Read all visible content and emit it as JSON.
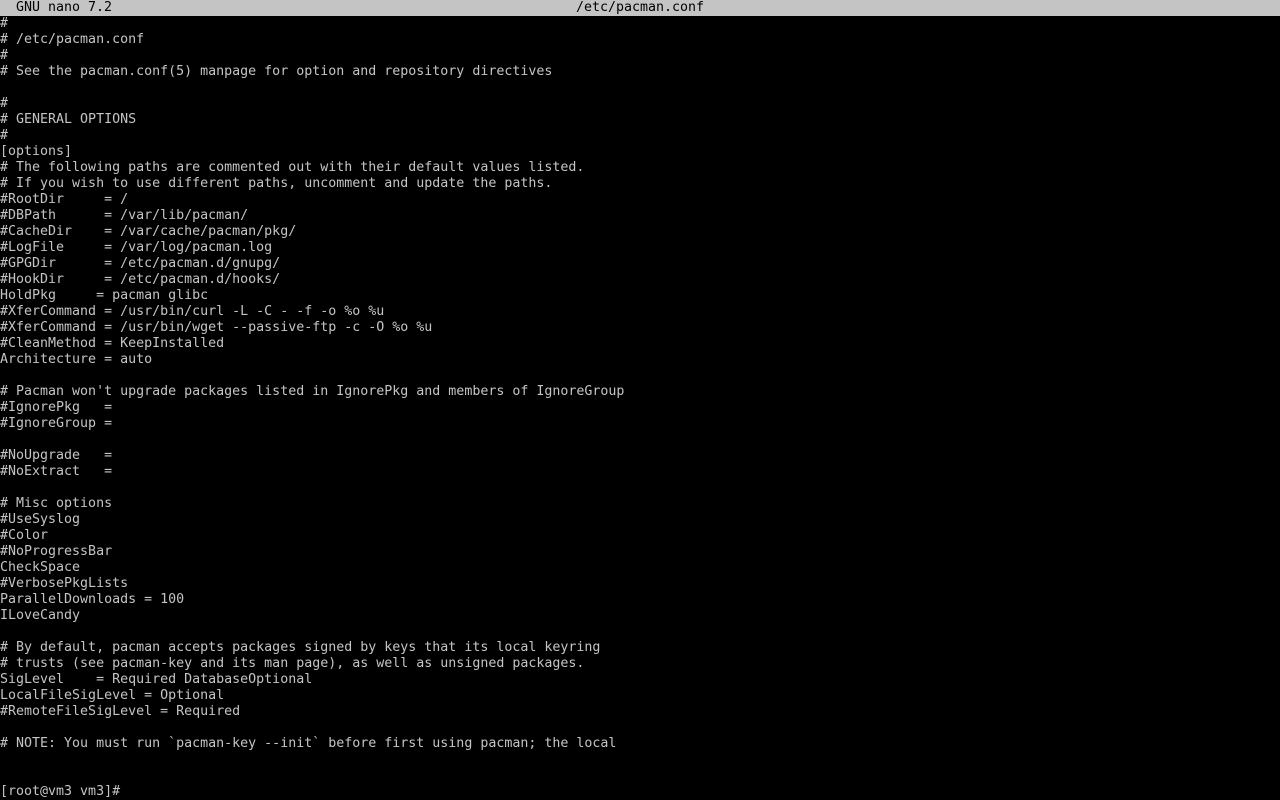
{
  "title_bar": {
    "app_name": "GNU nano 7.2",
    "file_name": "/etc/pacman.conf"
  },
  "editor": {
    "lines": [
      "#",
      "# /etc/pacman.conf",
      "#",
      "# See the pacman.conf(5) manpage for option and repository directives",
      "",
      "#",
      "# GENERAL OPTIONS",
      "#",
      "[options]",
      "# The following paths are commented out with their default values listed.",
      "# If you wish to use different paths, uncomment and update the paths.",
      "#RootDir     = /",
      "#DBPath      = /var/lib/pacman/",
      "#CacheDir    = /var/cache/pacman/pkg/",
      "#LogFile     = /var/log/pacman.log",
      "#GPGDir      = /etc/pacman.d/gnupg/",
      "#HookDir     = /etc/pacman.d/hooks/",
      "HoldPkg     = pacman glibc",
      "#XferCommand = /usr/bin/curl -L -C - -f -o %o %u",
      "#XferCommand = /usr/bin/wget --passive-ftp -c -O %o %u",
      "#CleanMethod = KeepInstalled",
      "Architecture = auto",
      "",
      "# Pacman won't upgrade packages listed in IgnorePkg and members of IgnoreGroup",
      "#IgnorePkg   =",
      "#IgnoreGroup =",
      "",
      "#NoUpgrade   =",
      "#NoExtract   =",
      "",
      "# Misc options",
      "#UseSyslog",
      "#Color",
      "#NoProgressBar",
      "CheckSpace",
      "#VerbosePkgLists",
      "ParallelDownloads = 100",
      "ILoveCandy",
      "",
      "# By default, pacman accepts packages signed by keys that its local keyring",
      "# trusts (see pacman-key and its man page), as well as unsigned packages.",
      "SigLevel    = Required DatabaseOptional",
      "LocalFileSigLevel = Optional",
      "#RemoteFileSigLevel = Required",
      "",
      "# NOTE: You must run `pacman-key --init` before first using pacman; the local"
    ]
  },
  "shell": {
    "prompt": "[root@vm3 vm3]#"
  }
}
